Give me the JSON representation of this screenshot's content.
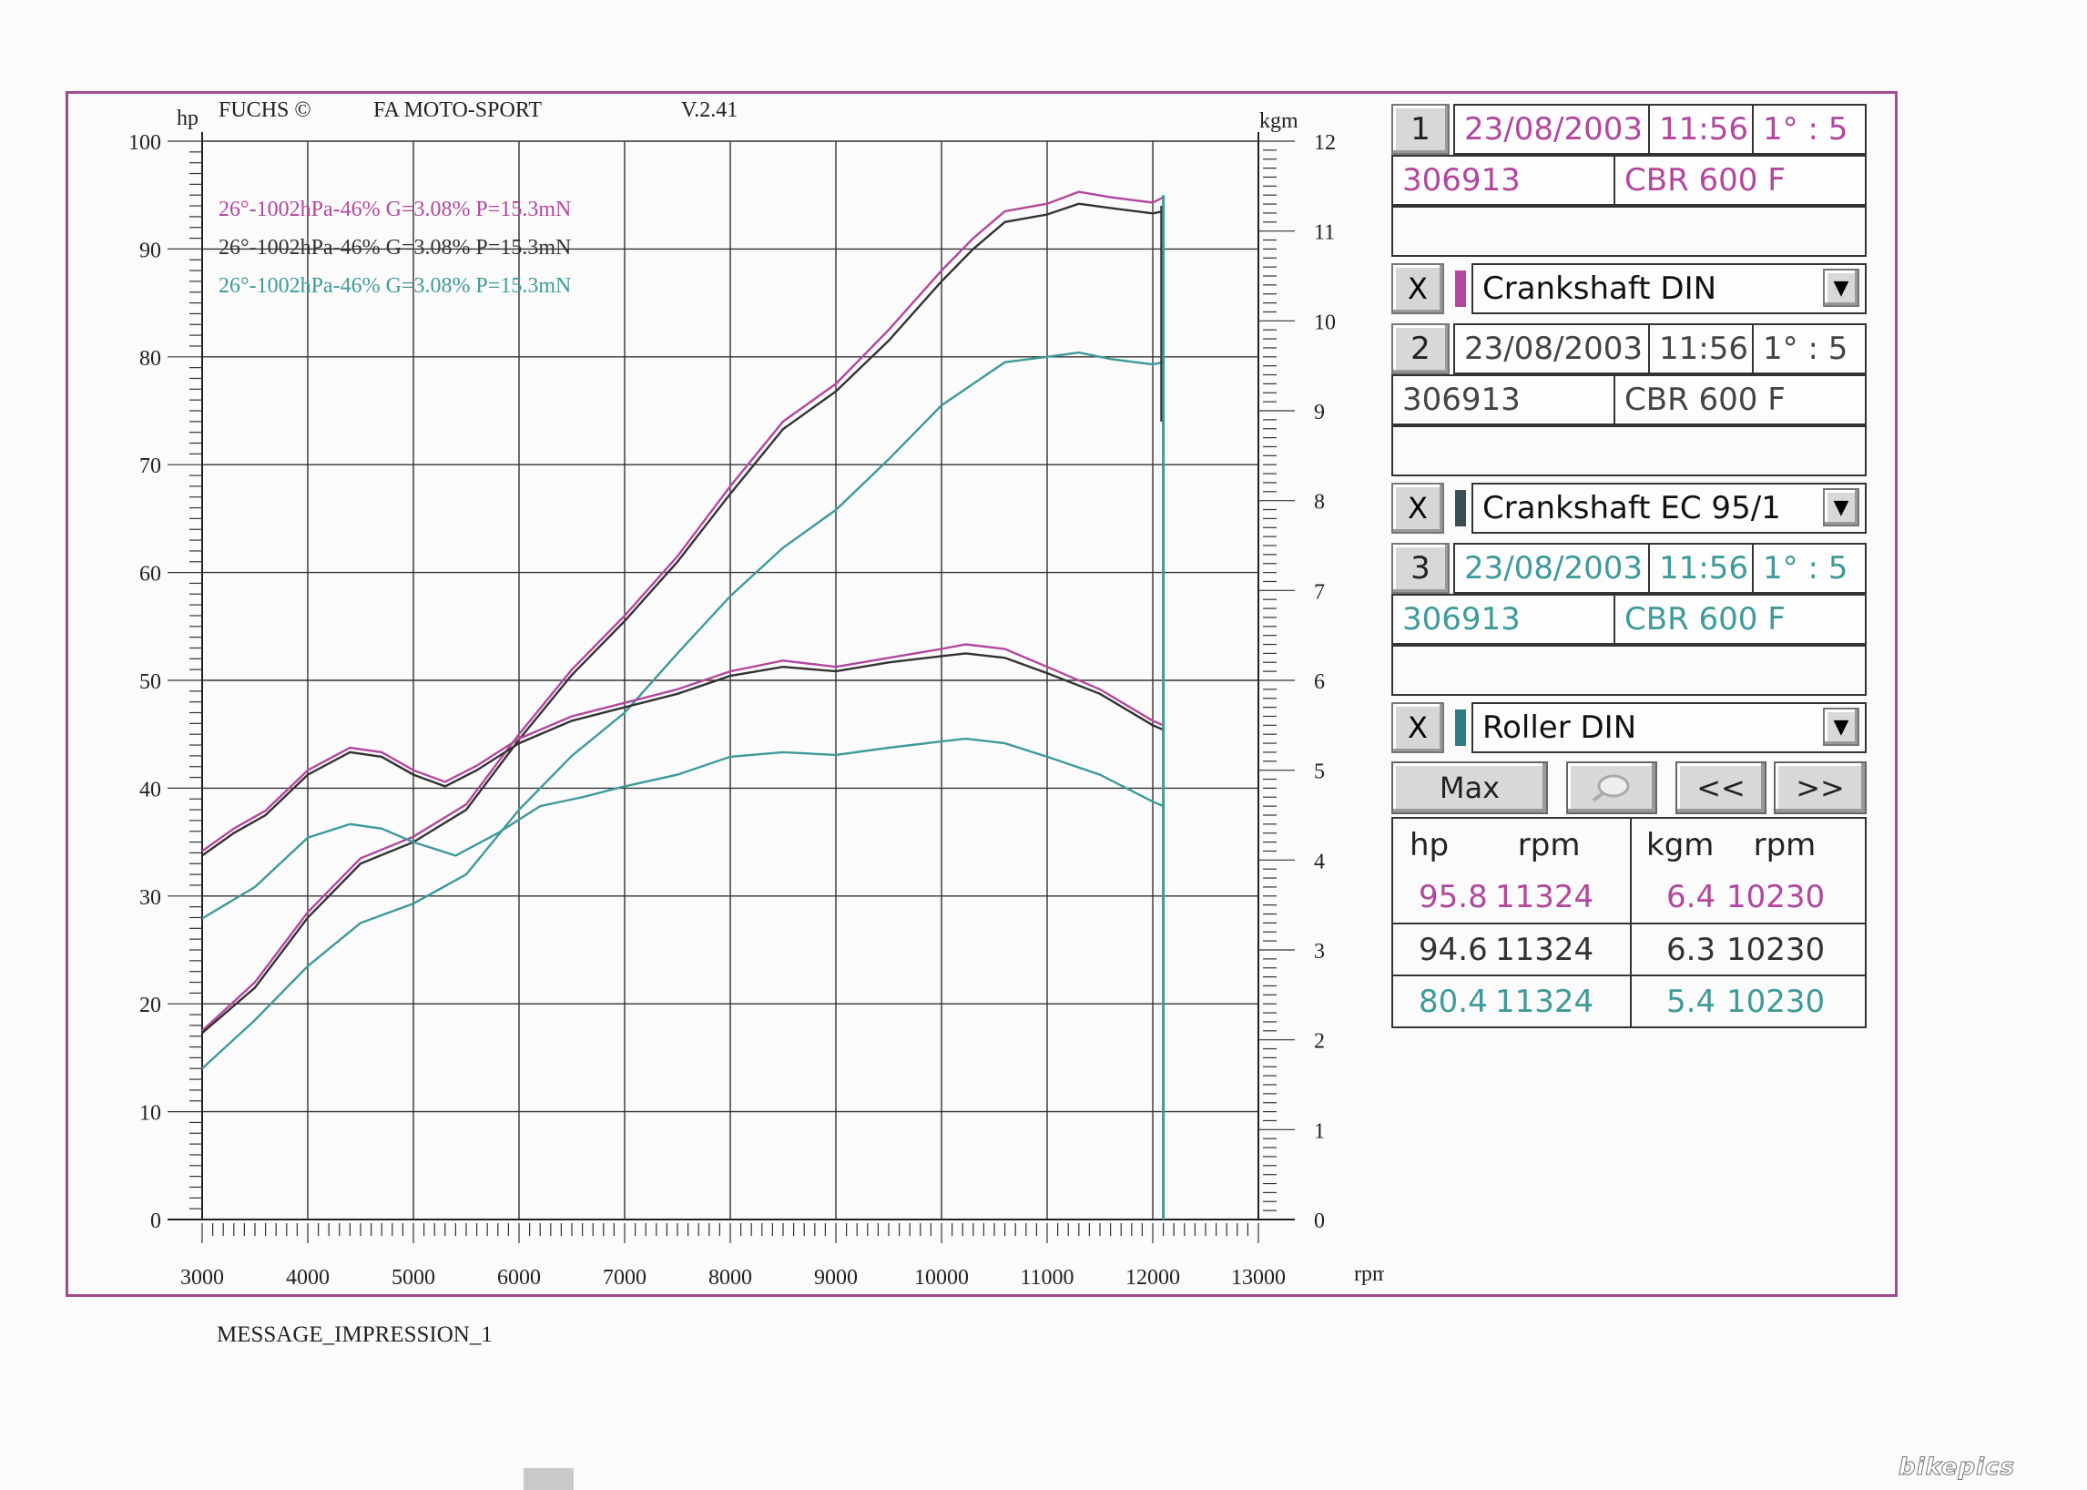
{
  "header": {
    "left_unit": "hp",
    "brand": "FUCHS ©",
    "company": "FA MOTO-SPORT",
    "version": "V.2.41",
    "right_unit": "kgm"
  },
  "legend_lines": [
    {
      "text": "26°-1002hPa-46% G=3.08% P=15.3mN",
      "color": "#b3479d"
    },
    {
      "text": "26°-1002hPa-46% G=3.08% P=15.3mN",
      "color": "#333333"
    },
    {
      "text": "26°-1002hPa-46% G=3.08% P=15.3mN",
      "color": "#3f9a9a"
    }
  ],
  "footer": "MESSAGE_IMPRESSION_1",
  "watermark": "bikepics",
  "chart_data": {
    "type": "line",
    "xlabel": "rpm",
    "ylabel_left": "hp",
    "ylabel_right": "kgm",
    "xlim": [
      3000,
      13000
    ],
    "ylim_left": [
      0,
      100
    ],
    "ylim_right": [
      0,
      12
    ],
    "x_ticks": [
      3000,
      4000,
      5000,
      6000,
      7000,
      8000,
      9000,
      10000,
      11000,
      12000,
      13000
    ],
    "y_left_ticks": [
      0,
      10,
      20,
      30,
      40,
      50,
      60,
      70,
      80,
      90,
      100
    ],
    "y_right_ticks": [
      0,
      1,
      2,
      3,
      4,
      5,
      6,
      7,
      8,
      9,
      10,
      11,
      12
    ],
    "grid": true,
    "series": [
      {
        "color": "#b3479d",
        "axis": "left",
        "points": [
          [
            3000,
            17.5
          ],
          [
            3500,
            22
          ],
          [
            4000,
            28.5
          ],
          [
            4500,
            33.5
          ],
          [
            5000,
            35.5
          ],
          [
            5500,
            38.5
          ],
          [
            6000,
            45
          ],
          [
            6500,
            51
          ],
          [
            7000,
            56
          ],
          [
            7500,
            61.5
          ],
          [
            8000,
            68
          ],
          [
            8500,
            74
          ],
          [
            9000,
            77.5
          ],
          [
            9500,
            82.5
          ],
          [
            10000,
            88
          ],
          [
            10300,
            91
          ],
          [
            10600,
            93.5
          ],
          [
            11000,
            94.2
          ],
          [
            11300,
            95.3
          ],
          [
            11600,
            94.8
          ],
          [
            12000,
            94.3
          ],
          [
            12100,
            94.8
          ]
        ]
      },
      {
        "color": "#333333",
        "axis": "left",
        "points": [
          [
            3000,
            17.3
          ],
          [
            3500,
            21.5
          ],
          [
            4000,
            28
          ],
          [
            4500,
            33
          ],
          [
            5000,
            35
          ],
          [
            5500,
            38
          ],
          [
            6000,
            44.5
          ],
          [
            6500,
            50.5
          ],
          [
            7000,
            55.5
          ],
          [
            7500,
            61
          ],
          [
            8000,
            67.3
          ],
          [
            8500,
            73.3
          ],
          [
            9000,
            76.8
          ],
          [
            9500,
            81.5
          ],
          [
            10000,
            87
          ],
          [
            10300,
            90
          ],
          [
            10600,
            92.5
          ],
          [
            11000,
            93.2
          ],
          [
            11300,
            94.2
          ],
          [
            11600,
            93.8
          ],
          [
            12000,
            93.3
          ],
          [
            12100,
            93.5
          ]
        ]
      },
      {
        "color": "#3f9a9a",
        "axis": "left",
        "points": [
          [
            3000,
            14
          ],
          [
            3500,
            18.5
          ],
          [
            4000,
            23.5
          ],
          [
            4500,
            27.5
          ],
          [
            5000,
            29.3
          ],
          [
            5500,
            32
          ],
          [
            6000,
            38
          ],
          [
            6500,
            43
          ],
          [
            7000,
            47
          ],
          [
            7500,
            52.5
          ],
          [
            8000,
            57.8
          ],
          [
            8500,
            62.3
          ],
          [
            9000,
            65.8
          ],
          [
            9500,
            70.5
          ],
          [
            10000,
            75.5
          ],
          [
            10300,
            77.5
          ],
          [
            10600,
            79.5
          ],
          [
            11000,
            80
          ],
          [
            11300,
            80.4
          ],
          [
            11600,
            79.8
          ],
          [
            12000,
            79.3
          ],
          [
            12100,
            79.5
          ]
        ]
      },
      {
        "color": "#b3479d",
        "axis": "right",
        "points": [
          [
            3000,
            4.1
          ],
          [
            3300,
            4.35
          ],
          [
            3600,
            4.55
          ],
          [
            4000,
            5.0
          ],
          [
            4400,
            5.25
          ],
          [
            4700,
            5.2
          ],
          [
            5000,
            5.0
          ],
          [
            5300,
            4.87
          ],
          [
            5600,
            5.05
          ],
          [
            6000,
            5.35
          ],
          [
            6500,
            5.6
          ],
          [
            7000,
            5.75
          ],
          [
            7500,
            5.9
          ],
          [
            8000,
            6.1
          ],
          [
            8500,
            6.22
          ],
          [
            9000,
            6.15
          ],
          [
            9500,
            6.25
          ],
          [
            10000,
            6.35
          ],
          [
            10230,
            6.4
          ],
          [
            10600,
            6.35
          ],
          [
            11000,
            6.15
          ],
          [
            11500,
            5.9
          ],
          [
            12000,
            5.55
          ],
          [
            12100,
            5.5
          ]
        ]
      },
      {
        "color": "#333333",
        "axis": "right",
        "points": [
          [
            3000,
            4.05
          ],
          [
            3300,
            4.3
          ],
          [
            3600,
            4.5
          ],
          [
            4000,
            4.95
          ],
          [
            4400,
            5.2
          ],
          [
            4700,
            5.15
          ],
          [
            5000,
            4.95
          ],
          [
            5300,
            4.82
          ],
          [
            5600,
            5.0
          ],
          [
            6000,
            5.3
          ],
          [
            6500,
            5.55
          ],
          [
            7000,
            5.7
          ],
          [
            7500,
            5.85
          ],
          [
            8000,
            6.05
          ],
          [
            8500,
            6.15
          ],
          [
            9000,
            6.1
          ],
          [
            9500,
            6.2
          ],
          [
            10000,
            6.27
          ],
          [
            10230,
            6.3
          ],
          [
            10600,
            6.25
          ],
          [
            11000,
            6.08
          ],
          [
            11500,
            5.85
          ],
          [
            12000,
            5.5
          ],
          [
            12100,
            5.45
          ]
        ]
      },
      {
        "color": "#3f9a9a",
        "axis": "right",
        "points": [
          [
            3000,
            3.35
          ],
          [
            3500,
            3.7
          ],
          [
            4000,
            4.25
          ],
          [
            4400,
            4.4
          ],
          [
            4700,
            4.35
          ],
          [
            5000,
            4.2
          ],
          [
            5400,
            4.05
          ],
          [
            5800,
            4.3
          ],
          [
            6200,
            4.6
          ],
          [
            6600,
            4.7
          ],
          [
            7000,
            4.82
          ],
          [
            7500,
            4.95
          ],
          [
            8000,
            5.15
          ],
          [
            8500,
            5.2
          ],
          [
            9000,
            5.17
          ],
          [
            9500,
            5.25
          ],
          [
            10000,
            5.32
          ],
          [
            10230,
            5.35
          ],
          [
            10600,
            5.3
          ],
          [
            11000,
            5.15
          ],
          [
            11500,
            4.95
          ],
          [
            12000,
            4.65
          ],
          [
            12100,
            4.6
          ]
        ]
      }
    ]
  },
  "panel": {
    "runs": [
      {
        "number": "1",
        "date": "23/08/2003",
        "time": "11:56",
        "ratio": "1° : 5",
        "id": "306913",
        "model": "CBR 600 F",
        "mode": "Crankshaft DIN",
        "color": "#b3479d",
        "swatch": "#b3479d"
      },
      {
        "number": "2",
        "date": "23/08/2003",
        "time": "11:56",
        "ratio": "1° : 5",
        "id": "306913",
        "model": "CBR 600 F",
        "mode": "Crankshaft EC 95/1",
        "color": "#444444",
        "swatch": "#3a4f55"
      },
      {
        "number": "3",
        "date": "23/08/2003",
        "time": "11:56",
        "ratio": "1° : 5",
        "id": "306913",
        "model": "CBR 600 F",
        "mode": "Roller DIN",
        "color": "#3f9a9a",
        "swatch": "#2e7b84"
      }
    ],
    "close_label": "X",
    "dropdown_icon": "triangle-down-icon",
    "buttons": {
      "max": "Max",
      "zoom_icon": "magnifier-icon",
      "prev": "<<",
      "next": ">>"
    },
    "max_table": {
      "headers": {
        "left": "hp       rpm",
        "right": "kgm    rpm"
      },
      "rows": [
        {
          "hp": "95.8",
          "hp_rpm": "11324",
          "kgm": "6.4",
          "kgm_rpm": "10230",
          "color": "#b3479d"
        },
        {
          "hp": "94.6",
          "hp_rpm": "11324",
          "kgm": "6.3",
          "kgm_rpm": "10230",
          "color": "#333333"
        },
        {
          "hp": "80.4",
          "hp_rpm": "11324",
          "kgm": "5.4",
          "kgm_rpm": "10230",
          "color": "#3f9a9a"
        }
      ]
    }
  }
}
